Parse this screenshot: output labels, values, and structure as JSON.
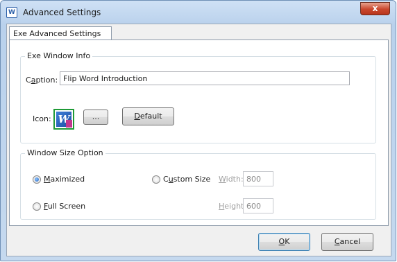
{
  "window": {
    "title": "Advanced Settings",
    "app_icon_glyph": "W",
    "close_glyph": "x"
  },
  "tabs": [
    {
      "label": "Exe Advanced Settings",
      "selected": true
    }
  ],
  "exe_window_info": {
    "group_title": "Exe Window Info",
    "caption_label_pre": "C",
    "caption_label_acc": "a",
    "caption_label_post": "ption:",
    "caption_value": "Flip Word Introduction",
    "icon_label": "Icon:",
    "icon_glyph": "W",
    "browse_label": "...",
    "default_label_acc": "D",
    "default_label_post": "efault"
  },
  "window_size_option": {
    "group_title": "Window Size Option",
    "maximized_acc": "M",
    "maximized_post": "aximized",
    "maximized_checked": true,
    "full_screen_acc": "F",
    "full_screen_post": "ull Screen",
    "full_screen_checked": false,
    "custom_size_pre": "C",
    "custom_size_acc": "u",
    "custom_size_post": "stom Size",
    "custom_size_checked": false,
    "width_acc": "W",
    "width_post": "idth:",
    "width_value": "800",
    "height_acc": "H",
    "height_post": "eight:",
    "height_value": "600"
  },
  "footer": {
    "ok_acc": "O",
    "ok_post": "K",
    "cancel_acc": "C",
    "cancel_post": "ancel"
  },
  "colors": {
    "frame": "#b9d1ec",
    "close": "#c9472d",
    "icon_border": "#1e9a36",
    "radio_dot": "#1f5fbf"
  }
}
